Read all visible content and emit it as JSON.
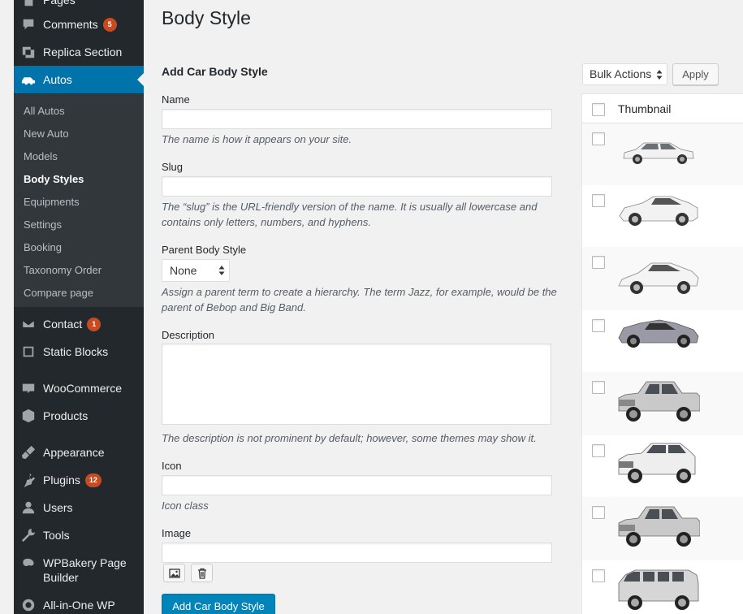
{
  "sidebar": {
    "menu": [
      {
        "label": "Pages",
        "icon": "pages-icon"
      },
      {
        "label": "Comments",
        "badge": "5",
        "icon": "comments-icon"
      },
      {
        "label": "Replica Section",
        "icon": "replica-section-icon"
      },
      {
        "label": "Autos",
        "icon": "car-icon",
        "active": true
      },
      {
        "label": "Contact",
        "badge": "1",
        "icon": "mail-icon"
      },
      {
        "label": "Static Blocks",
        "icon": "static-blocks-icon"
      },
      {
        "label": "WooCommerce",
        "icon": "woocommerce-icon"
      },
      {
        "label": "Products",
        "icon": "products-icon"
      },
      {
        "label": "Appearance",
        "icon": "appearance-icon"
      },
      {
        "label": "Plugins",
        "badge": "12",
        "icon": "plugins-icon"
      },
      {
        "label": "Users",
        "icon": "users-icon"
      },
      {
        "label": "Tools",
        "icon": "tools-icon"
      },
      {
        "label": "WPBakery Page Builder",
        "icon": "wpbakery-icon"
      },
      {
        "label": "All-in-One WP",
        "icon": "all-in-one-wp-icon"
      }
    ],
    "submenu": [
      {
        "label": "All Autos"
      },
      {
        "label": "New Auto"
      },
      {
        "label": "Models"
      },
      {
        "label": "Body Styles",
        "current": true
      },
      {
        "label": "Equipments"
      },
      {
        "label": "Settings"
      },
      {
        "label": "Booking"
      },
      {
        "label": "Taxonomy Order"
      },
      {
        "label": "Compare page"
      }
    ]
  },
  "page": {
    "title": "Body Style"
  },
  "form": {
    "title": "Add Car Body Style",
    "name_label": "Name",
    "name_value": "",
    "name_help": "The name is how it appears on your site.",
    "slug_label": "Slug",
    "slug_value": "",
    "slug_help": "The “slug” is the URL-friendly version of the name. It is usually all lowercase and contains only letters, numbers, and hyphens.",
    "parent_label": "Parent Body Style",
    "parent_value": "None",
    "parent_help": "Assign a parent term to create a hierarchy. The term Jazz, for example, would be the parent of Bebop and Big Band.",
    "description_label": "Description",
    "description_value": "",
    "description_help": "The description is not prominent by default; however, some themes may show it.",
    "icon_label": "Icon",
    "icon_value": "",
    "icon_help": "Icon class",
    "image_label": "Image",
    "image_value": "",
    "submit_label": "Add Car Body Style"
  },
  "list": {
    "bulk_actions_label": "Bulk Actions",
    "apply_label": "Apply",
    "column_thumbnail": "Thumbnail",
    "rows": [
      {
        "thumbnail": "sedan-white",
        "color": "#f2f2f2"
      },
      {
        "thumbnail": "sports-car-white",
        "color": "#f2f2f2"
      },
      {
        "thumbnail": "supercar-white",
        "color": "#f2f2f2"
      },
      {
        "thumbnail": "hypercar-silver",
        "color": "#9a9aa6"
      },
      {
        "thumbnail": "pickup-truck-silver",
        "color": "#c9c9c9"
      },
      {
        "thumbnail": "suv-white",
        "color": "#eeeeee"
      },
      {
        "thumbnail": "pickup-truck-silver",
        "color": "#c9c9c9"
      },
      {
        "thumbnail": "van-silver",
        "color": "#d6d6d6"
      }
    ]
  }
}
